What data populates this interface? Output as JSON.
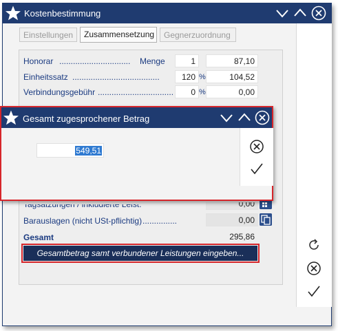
{
  "window": {
    "title": "Kostenbestimmung"
  },
  "tabs": [
    {
      "label": "Einstellungen",
      "active": false
    },
    {
      "label": "Zusammensetzung",
      "active": true
    },
    {
      "label": "Gegnerzuordnung",
      "active": false
    }
  ],
  "rows": {
    "honorar": {
      "label": "Honorar",
      "dots": "...............................",
      "sub_label": "Menge",
      "qty": "1",
      "value": "87,10"
    },
    "einheitssatz": {
      "label": "Einheitssatz",
      "dots": "......................................",
      "qty": "120",
      "unit": "%",
      "value": "104,52"
    },
    "verbindung": {
      "label": "Verbindungsgebühr",
      "dots": ".................................",
      "qty": "0",
      "unit": "%",
      "value": "0,00"
    },
    "tagsatzung": {
      "label": "Tagsatzungen / inkludierte Leist.",
      "value": "0,00"
    },
    "barauslagen": {
      "label": "Barauslagen (nicht USt-pflichtig)",
      "dots": "...............",
      "value": "0,00"
    },
    "gesamt": {
      "label": "Gesamt",
      "value": "295,86"
    }
  },
  "gesamt_button": {
    "label": "Gesamtbetrag samt verbundener Leistungen eingeben..."
  },
  "dialog": {
    "title": "Gesamt zugesprochener Betrag",
    "input_value": "549,51"
  },
  "icons": {
    "app": "star-icon",
    "minimize": "chevron-down-icon",
    "maximize": "chevron-up-icon",
    "close": "close-circle-icon",
    "refresh": "refresh-icon",
    "cancel": "cancel-circle-icon",
    "confirm": "checkmark-icon",
    "calculator": "calculator-icon"
  },
  "colors": {
    "titlebar": "#1f3b70",
    "highlight": "#d6252a",
    "label": "#1a3a80",
    "selection": "#2f7ad1"
  }
}
